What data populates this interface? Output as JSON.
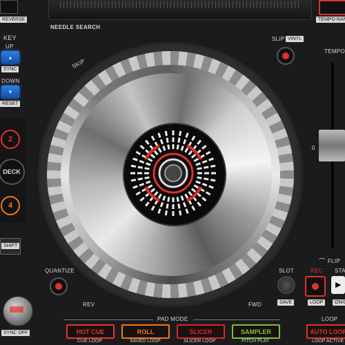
{
  "needle": {
    "label": "NEEDLE SEARCH"
  },
  "top_left": {
    "reverse": "REVERSE"
  },
  "top_right": {
    "tempo_range": "TEMPO RAN"
  },
  "key": {
    "title": "KEY",
    "up": "UP",
    "sync": "SYNC",
    "down": "DOWN",
    "reset": "RESET"
  },
  "deck": {
    "num2": "2",
    "label": "DECK",
    "num4": "4"
  },
  "shift": "SHIFT",
  "sync_off": "SYNC OFF",
  "slip": {
    "label": "SLIP",
    "vinyl": "VINYL"
  },
  "tempo": "TEMPO",
  "skip": "SKIP",
  "quantize": "QUANTIZE",
  "rev": "REV",
  "fwd": "FWD",
  "slot": {
    "label": "SLOT",
    "save": "SAVE"
  },
  "rec": {
    "label": "REC",
    "loop": "LOOP"
  },
  "start": {
    "label": "STA",
    "onoff": "ON/O"
  },
  "flip": "FLIP",
  "pad_mode": {
    "title": "PAD MODE",
    "pads": [
      {
        "label": "HOT CUE",
        "sub": "CUE LOOP",
        "color": "#e0392b"
      },
      {
        "label": "ROLL",
        "sub": "SAVED LOOP",
        "color": "#f07a1a"
      },
      {
        "label": "SLICER",
        "sub": "SLICER LOOP",
        "color": "#d6262c"
      },
      {
        "label": "SAMPLER",
        "sub": "PITCH PLAY",
        "color": "#7ac23a"
      }
    ]
  },
  "loop": {
    "title": "LOOP",
    "auto": "AUTO LOOP",
    "active": "LOOP ACTIVE"
  },
  "tempo_zero": "0",
  "colors": {
    "accent_red": "#e0322b",
    "accent_blue": "#2c7fff"
  }
}
